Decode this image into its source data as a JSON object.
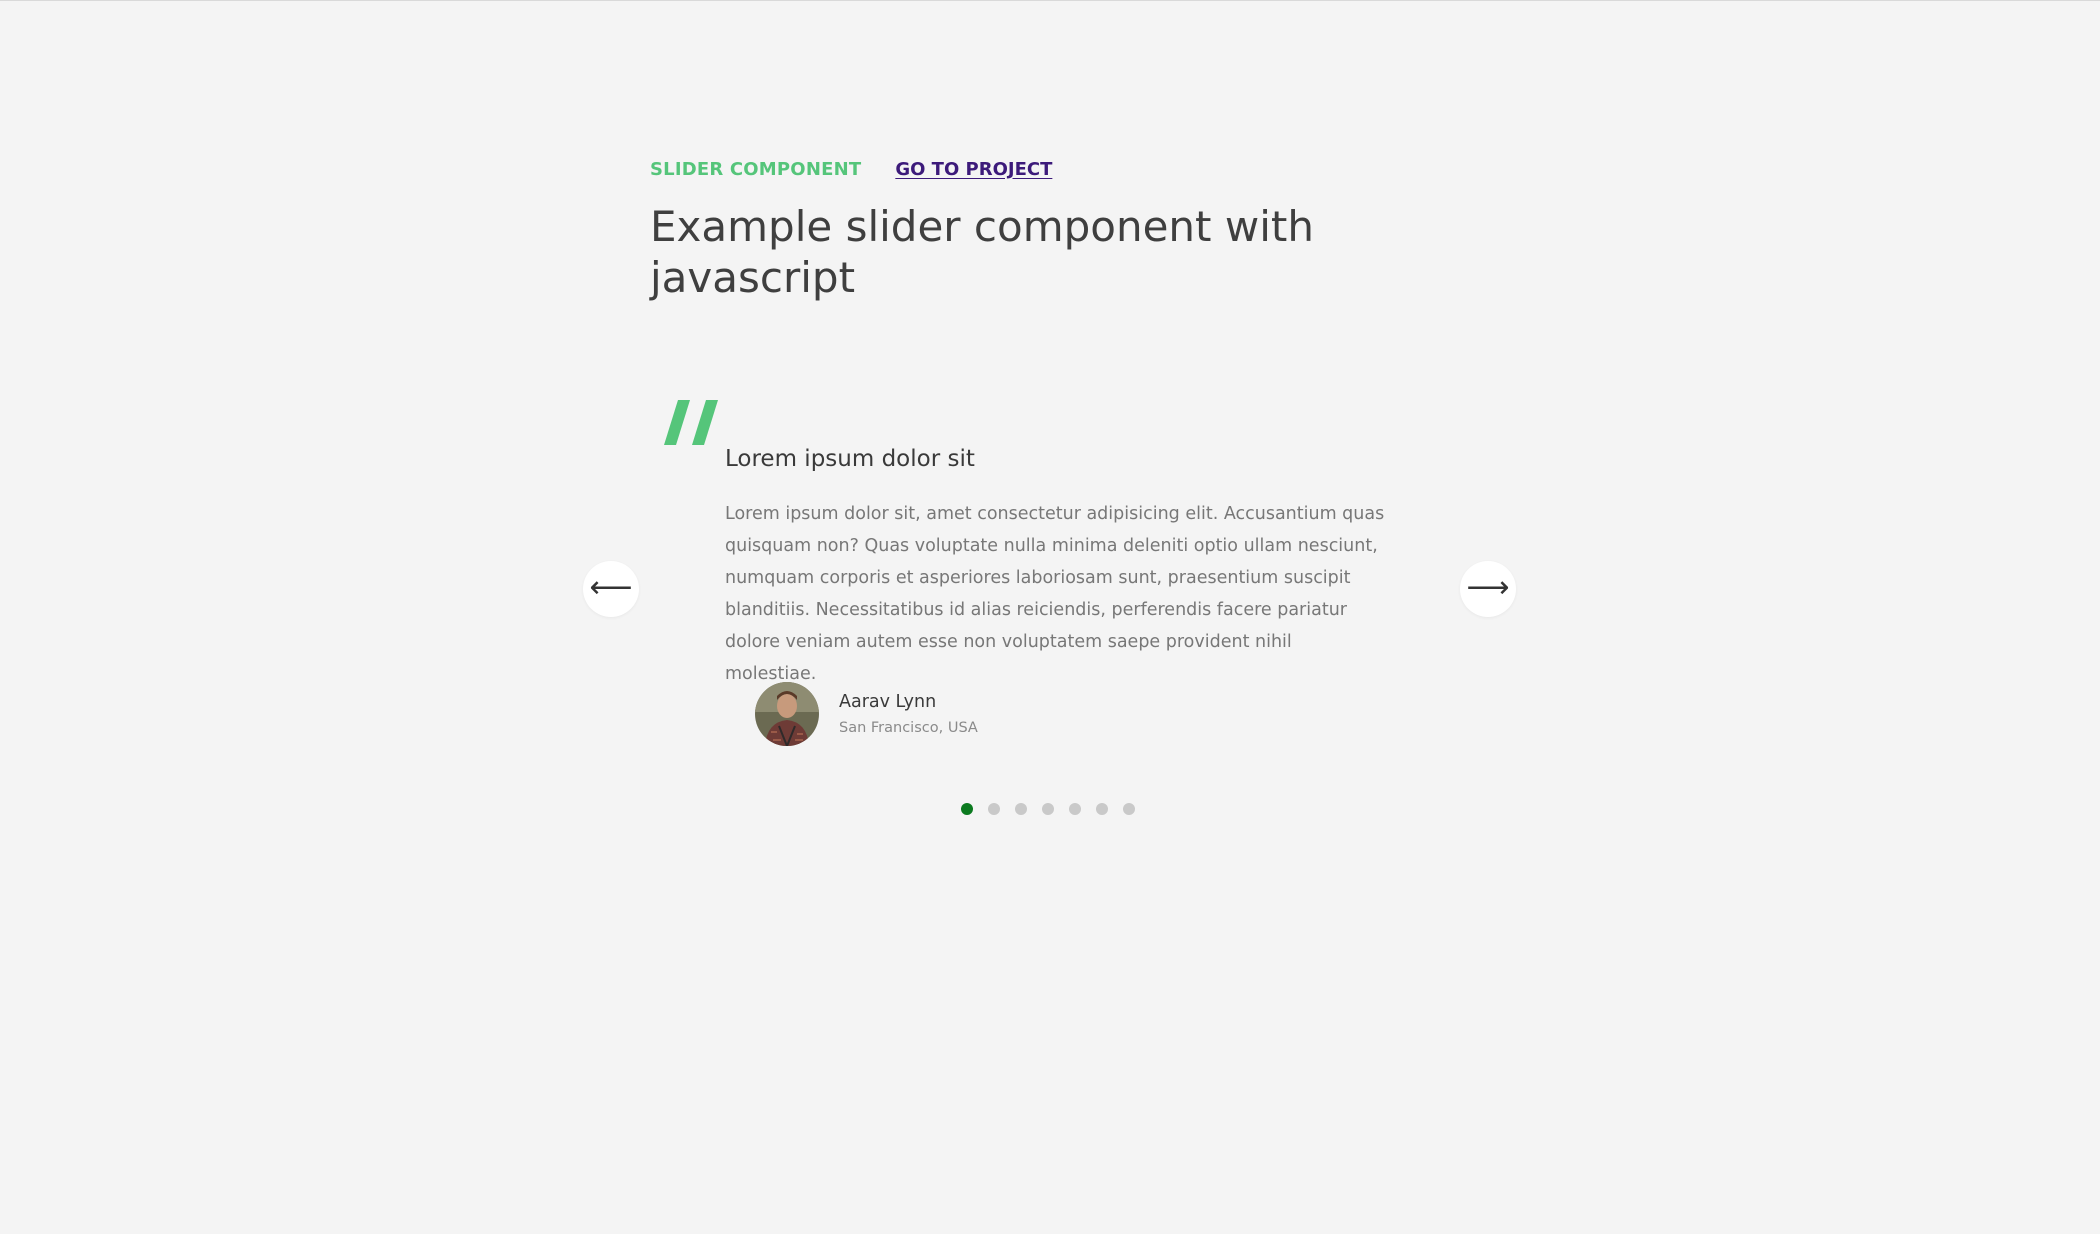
{
  "header": {
    "tag": "SLIDER COMPONENT",
    "project_link": "GO TO PROJECT",
    "title": "Example slider component with javascript"
  },
  "slider": {
    "prev_icon": "arrow-left-icon",
    "next_icon": "arrow-right-icon",
    "prev_glyph": "⟵",
    "next_glyph": "⟶",
    "slide": {
      "quote_icon": "quote-icon",
      "title": "Lorem ipsum dolor sit",
      "text": "Lorem ipsum dolor sit, amet consectetur adipisicing elit. Accusantium quas quisquam non? Quas voluptate nulla minima deleniti optio ullam nesciunt, numquam corporis et asperiores laboriosam sunt, praesentium suscipit blanditiis. Necessitatibus id alias reiciendis, perferendis facere pariatur dolore veniam autem esse non voluptatem saepe provident nihil molestiae.",
      "author": {
        "name": "Aarav Lynn",
        "place": "San Francisco, USA"
      }
    },
    "dots": {
      "count": 7,
      "active_index": 0
    }
  },
  "colors": {
    "accent_green": "#55c57a",
    "link_purple": "#3c1a7a",
    "active_dot": "#0b7a1f",
    "inactive_dot": "#c9c9c9",
    "background": "#f4f4f4"
  }
}
